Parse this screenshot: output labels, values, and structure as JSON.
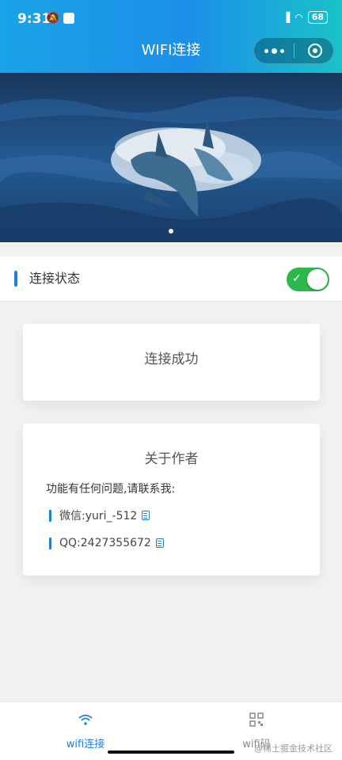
{
  "status_bar": {
    "time": "9:31",
    "battery": "68"
  },
  "header": {
    "title": "WIFI连接"
  },
  "banner": {
    "image_alt": "dolphins in ocean"
  },
  "connection": {
    "label": "连接状态",
    "switch_on": true
  },
  "result_card": {
    "message": "连接成功"
  },
  "author_card": {
    "title": "关于作者",
    "intro": "功能有任何问题,请联系我:",
    "contacts": [
      {
        "text": "微信:yuri_-512"
      },
      {
        "text": "QQ:2427355672"
      }
    ]
  },
  "tabbar": {
    "tabs": [
      {
        "label": "wifi连接",
        "active": true
      },
      {
        "label": "wifi码",
        "active": false
      }
    ],
    "watermark": "@稀土掘金技术社区"
  },
  "colors": {
    "accent": "#1b7fe0",
    "switch_on": "#2db84d",
    "header_gradient_start": "#1aa3e6",
    "header_gradient_end": "#19c3c9"
  }
}
